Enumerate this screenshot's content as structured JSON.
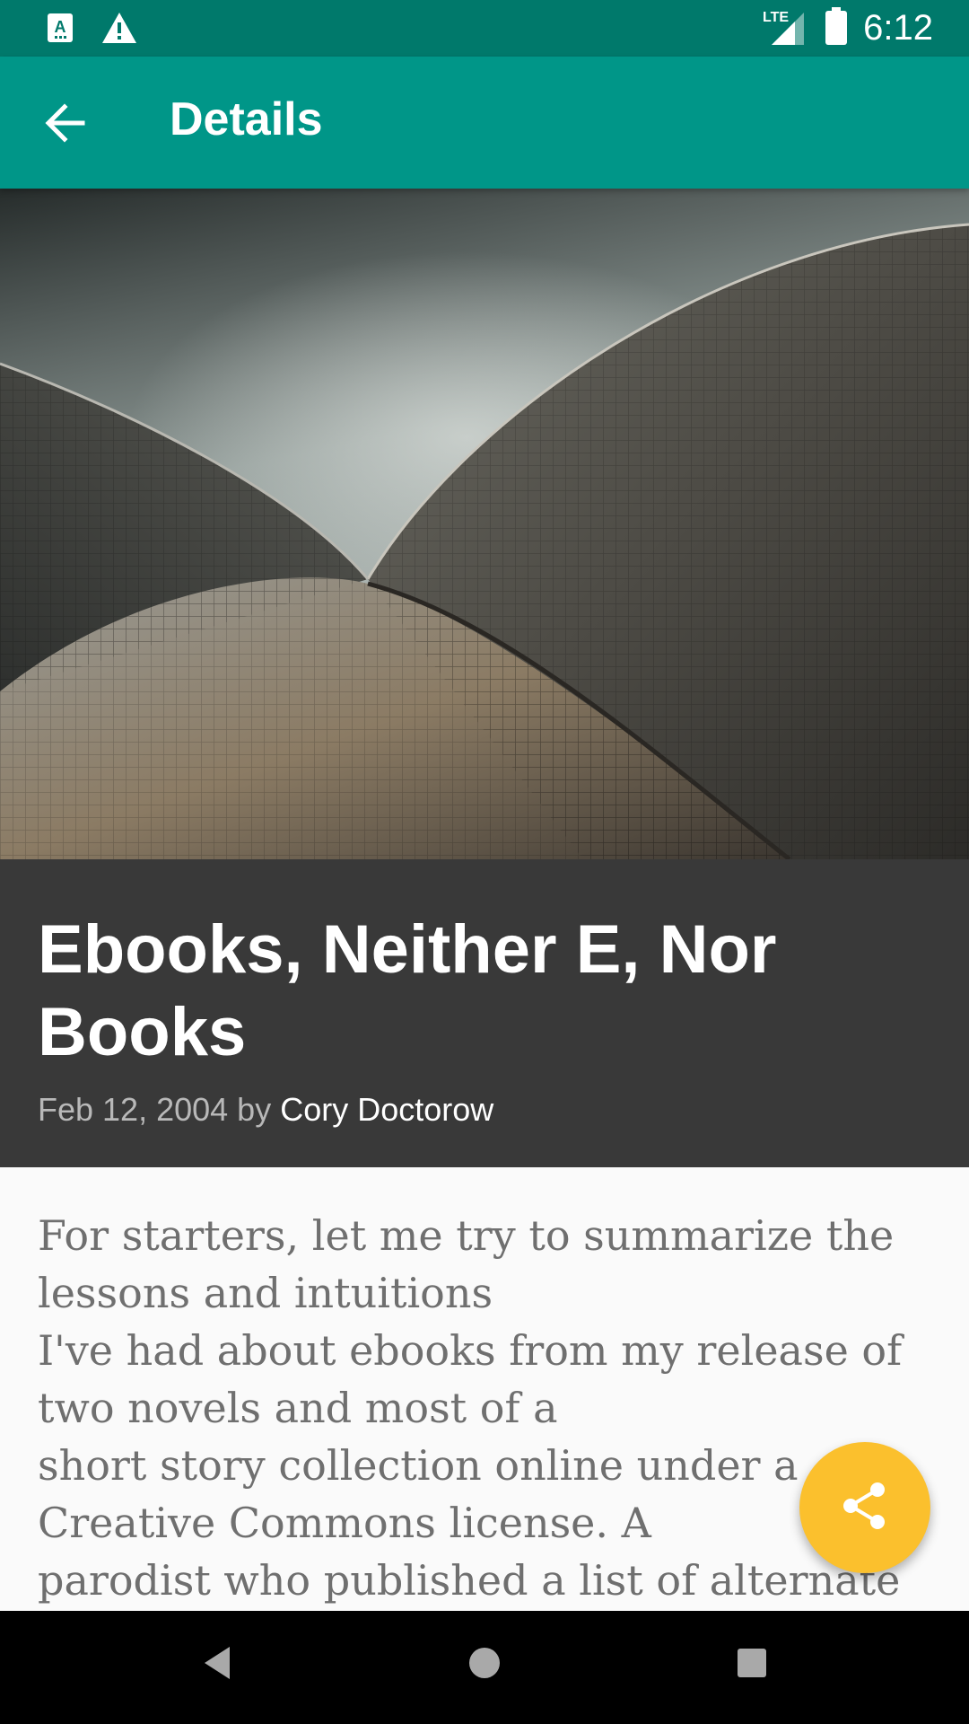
{
  "status_bar": {
    "time": "6:12",
    "network": "LTE",
    "icons": [
      "a-notification-icon",
      "warning-icon",
      "signal-icon",
      "battery-icon"
    ]
  },
  "app_bar": {
    "title": "Details",
    "back_icon": "arrow-back-icon"
  },
  "article": {
    "image": "opera-house-roof-photo",
    "title": "Ebooks, Neither E, Nor Books",
    "date_prefix": "Feb 12, 2004 by ",
    "author": "Cory Doctorow",
    "body": "For starters, let me try to summarize the lessons and intuitions\nI've had about ebooks from my release of two novels and most of a\nshort story collection online under a Creative Commons license. A\nparodist who published a list of alternate"
  },
  "fab": {
    "icon": "share-icon"
  },
  "nav_bar": {
    "icons": [
      "back-triangle-icon",
      "home-circle-icon",
      "recents-square-icon"
    ]
  },
  "colors": {
    "status_bar": "#00796b",
    "app_bar": "#009688",
    "header_block": "#393939",
    "fab": "#fbc02d"
  }
}
